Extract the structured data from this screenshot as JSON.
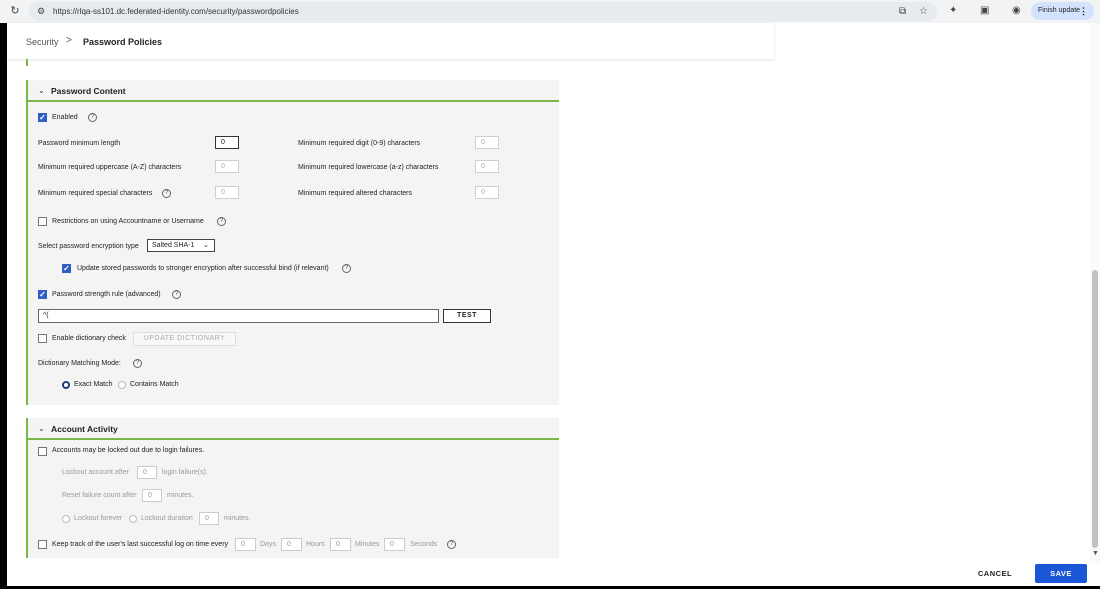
{
  "browser": {
    "url": "https://rlqa-ss101.dc.federated-identity.com/security/passwordpolicies",
    "finish_update_label": "Finish update"
  },
  "breadcrumb": {
    "parent": "Security",
    "separator": ">",
    "current": "Password Policies"
  },
  "password_content": {
    "title": "Password Content",
    "enabled_label": "Enabled",
    "min_length_label": "Password minimum length",
    "min_length_value": "0",
    "min_upper_label": "Minimum required uppercase (A-Z) characters",
    "min_upper_value": "0",
    "min_special_label": "Minimum required special characters",
    "min_special_value": "0",
    "min_digit_label": "Minimum required digit (0-9) characters",
    "min_digit_value": "0",
    "min_lower_label": "Minimum required lowercase (a-z) characters",
    "min_lower_value": "0",
    "min_altered_label": "Minimum required altered characters",
    "min_altered_value": "0",
    "restrictions_label": "Restrictions on using Accountname or Username",
    "encryption_label": "Select password encryption type",
    "encryption_value": "Salted SHA-1",
    "update_stored_label": "Update stored passwords to stronger encryption after successful bind (if relevant)",
    "strength_rule_label": "Password strength rule (advanced)",
    "strength_rule_value": "^(",
    "test_label": "TEST",
    "dictionary_check_label": "Enable dictionary check",
    "update_dictionary_label": "UPDATE DICTIONARY",
    "matching_mode_label": "Dictionary Matching Mode:",
    "exact_match_label": "Exact Match",
    "contains_match_label": "Contains Match"
  },
  "account_activity": {
    "title": "Account Activity",
    "locked_label": "Accounts may be locked out due to login failures.",
    "lockout_after_label": "Lockout account after",
    "lockout_after_value": "0",
    "lockout_after_suffix": "login failure(s).",
    "reset_failure_label": "Reset failure count after",
    "reset_failure_value": "0",
    "reset_failure_suffix": "minutes.",
    "lockout_forever_label": "Lockout forever",
    "lockout_duration_label": "Lockout duration",
    "lockout_duration_value": "0",
    "lockout_duration_suffix": "minutes.",
    "keep_track_label": "Keep track of the user's last successful log on time every",
    "days_value": "0",
    "days_label": "Days",
    "hours_value": "0",
    "hours_label": "Hours",
    "minutes_value": "0",
    "minutes_label": "Minutes",
    "seconds_value": "0",
    "seconds_label": "Seconds"
  },
  "footer": {
    "cancel_label": "CANCEL",
    "save_label": "SAVE"
  },
  "colors": {
    "accent_green": "#7ab648",
    "primary_blue": "#1a56d6",
    "checkbox_blue": "#2f5fc4"
  }
}
